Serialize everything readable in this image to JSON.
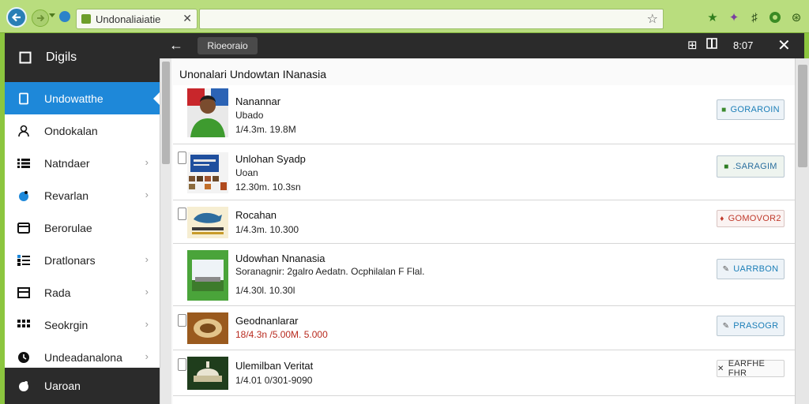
{
  "browser": {
    "tab_title": "Undonaliaiatie",
    "address_value": "",
    "fav_star": "☆"
  },
  "sidebar": {
    "header": "Digils",
    "items": [
      {
        "label": "Undowatthe",
        "icon": "tablet-icon",
        "active": true
      },
      {
        "label": "Ondokalan",
        "icon": "person-icon"
      },
      {
        "label": "Natndaer",
        "icon": "list-icon",
        "chevron": true
      },
      {
        "label": "Revarlan",
        "icon": "drop-icon",
        "chevron": true
      },
      {
        "label": "Berorulae",
        "icon": "card-icon"
      },
      {
        "label": "Dratlonars",
        "icon": "grid-list-icon",
        "chevron": true
      },
      {
        "label": "Rada",
        "icon": "window-icon",
        "chevron": true
      },
      {
        "label": "Seokrgin",
        "icon": "apps-icon",
        "chevron": true
      },
      {
        "label": "Undeadanalona",
        "icon": "clock-icon",
        "chevron": true
      }
    ],
    "footer": "Uaroan"
  },
  "header": {
    "chip": "Rioeoraio",
    "time": "8:07"
  },
  "list": {
    "title": "Unonalari  Undowtan INanasia",
    "rows": [
      {
        "title": "Nanannar",
        "sub": "Ubado",
        "meta": "1/4.3m. 19.8M",
        "meta_red": false,
        "action": "GORAROIN",
        "action_icon": "■",
        "action_color": "#1c7fb8",
        "icon_color": "#3c8a2e"
      },
      {
        "title": "Unlohan Syadp",
        "sub": "Uoan",
        "meta": "12.30m. 10.3sn",
        "meta_red": false,
        "action": ".SARAGIM",
        "action_icon": "■",
        "action_color": "#2a6e9e",
        "icon_color": "#2e7d23"
      },
      {
        "title": "Rocahan",
        "sub": "",
        "meta": "1/4.3m. 10.300",
        "meta_red": false,
        "action": "GOMOVOR2",
        "action_icon": "♦",
        "action_color": "#c0392b",
        "icon_color": "#c0392b"
      },
      {
        "title": "Udowhan Nnanasia",
        "sub": "Soranagnir: 2galro Aedatn. Ocphilalan F Flal.",
        "meta": "1/4.30l. 10.30l",
        "meta_red": false,
        "action": "UARRBON",
        "action_icon": "✎",
        "action_color": "#1c7fb8",
        "icon_color": "#555555"
      },
      {
        "title": "Geodnanlarar",
        "sub": "",
        "meta": "18/4.3n /5.00M. 5.000",
        "meta_red": true,
        "action": "PRASOGR",
        "action_icon": "✎",
        "action_color": "#1c7fb8",
        "icon_color": "#555555"
      },
      {
        "title": "Ulemilban Veritat",
        "sub": "",
        "meta": "1/4.01 0/301-9090",
        "meta_red": false,
        "action": "EARFHE FHR",
        "action_icon": "✕",
        "action_color": "#333333",
        "icon_color": "#333333"
      }
    ]
  },
  "colors": {
    "chrome_green": "#8cc63f",
    "dark": "#2b2b2b",
    "active_blue": "#1e88d9"
  }
}
